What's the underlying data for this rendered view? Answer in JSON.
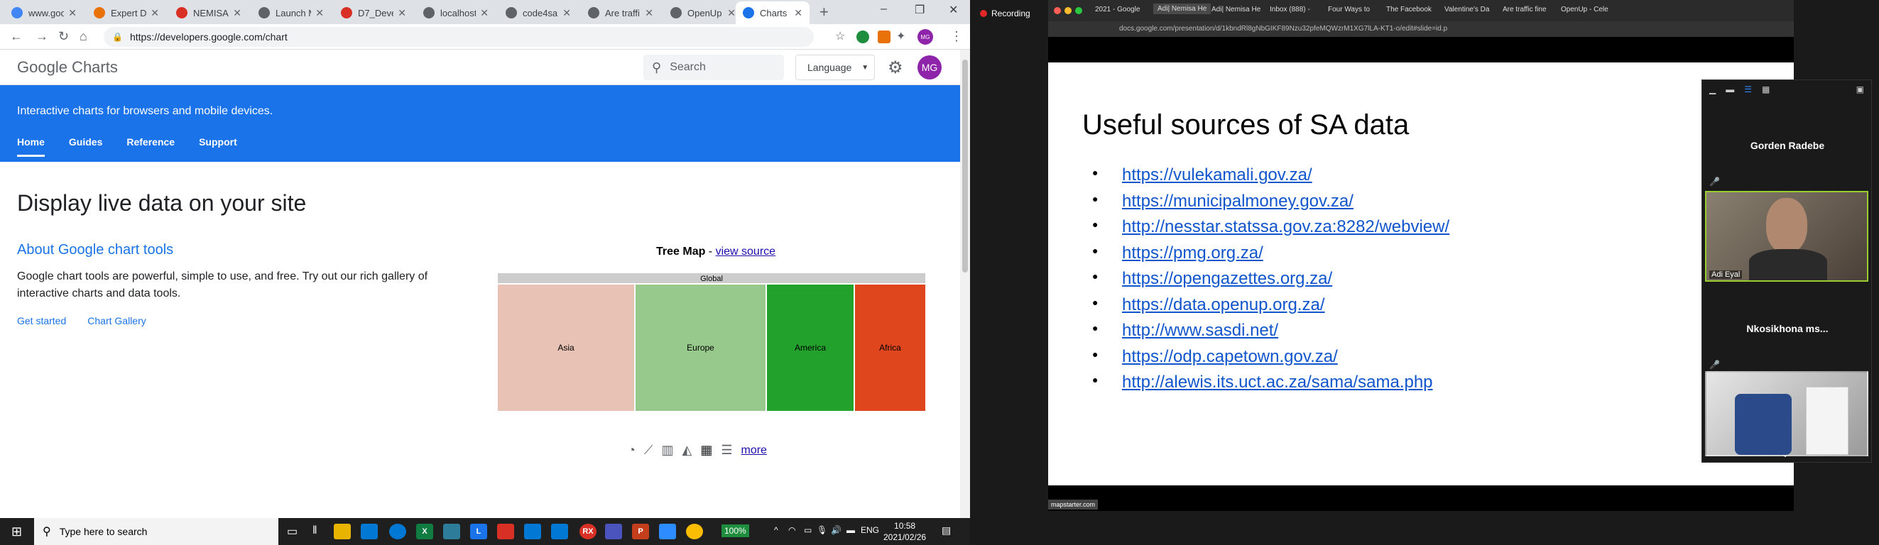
{
  "browser": {
    "tabs": [
      {
        "label": "www.goo",
        "color": "#4285f4",
        "letter": "G"
      },
      {
        "label": "Expert Da",
        "color": "#e8710a",
        "letter": "E"
      },
      {
        "label": "NEMISA",
        "color": "#d93025",
        "letter": "M"
      },
      {
        "label": "Launch M",
        "color": "#5f6368",
        "letter": "L"
      },
      {
        "label": "D7_Deve",
        "color": "#d93025",
        "letter": "P"
      },
      {
        "label": "localhost",
        "color": "#5f6368",
        "letter": "L"
      },
      {
        "label": "code4sa",
        "color": "#5f6368",
        "letter": "C"
      },
      {
        "label": "Are traffi",
        "color": "#5f6368",
        "letter": "A"
      },
      {
        "label": "OpenUp",
        "color": "#5f6368",
        "letter": "O"
      },
      {
        "label": "Charts |",
        "color": "#1a73e8",
        "letter": "<>"
      }
    ],
    "url": "https://developers.google.com/chart",
    "profile_initials": "MG"
  },
  "site": {
    "logo": "Google Charts",
    "search_placeholder": "Search",
    "language": "Language",
    "avatar": "MG",
    "tagline": "Interactive charts for browsers and mobile devices.",
    "nav": [
      "Home",
      "Guides",
      "Reference",
      "Support"
    ],
    "heading": "Display live data on your site",
    "about_title": "About Google chart tools",
    "about_text": "Google chart tools are powerful, simple to use, and free. Try out our rich gallery of interactive charts and data tools.",
    "link_get_started": "Get started",
    "link_gallery": "Chart Gallery",
    "treemap_title": "Tree Map",
    "treemap_sep": " - ",
    "view_source": "view source",
    "more": "more"
  },
  "chart_data": {
    "type": "treemap",
    "title": "Tree Map",
    "root": "Global",
    "categories": [
      "Asia",
      "Europe",
      "America",
      "Africa"
    ],
    "values": [
      0.32,
      0.305,
      0.205,
      0.165
    ],
    "colors": [
      "#e8c3b5",
      "#97c88c",
      "#22a22d",
      "#e0461e"
    ]
  },
  "taskbar": {
    "search_placeholder": "Type here to search",
    "battery": "100%",
    "lang": "ENG",
    "time": "10:58",
    "date": "2021/02/26"
  },
  "zoom": {
    "recording": "Recording",
    "shared_tabs": [
      "2021 - Google",
      "Adi| Nemisa He",
      "Adi| Nemisa He",
      "Inbox (888) -",
      "Four Ways to",
      "The Facebook",
      "Valentine's Da",
      "Are traffic fine",
      "OpenUp - Cele"
    ],
    "shared_url": "docs.google.com/presentation/d/1kbndRl8gNbGIKF89Nzu32pfeMQWzrM1XG7lLA-KT1-o/edit#slide=id.p",
    "slide_title": "Useful sources of SA data",
    "slide_links": [
      "https://vulekamali.gov.za/",
      "https://municipalmoney.gov.za/",
      "http://nesstar.statssa.gov.za:8282/webview/",
      "https://pmg.org.za/",
      "https://opengazettes.org.za/",
      "https://data.openup.org.za/",
      "http://www.sasdi.net/",
      "https://odp.capetown.gov.za/",
      "http://alewis.its.uct.ac.za/sama/sama.php"
    ],
    "bottom_label": "mapstarter.com",
    "participants": [
      {
        "name": "Gorden Radebe"
      },
      {
        "name": "Adi Eyal",
        "video_label": "Adi Eyal"
      },
      {
        "name": "Nkosikhona ms..."
      }
    ]
  }
}
